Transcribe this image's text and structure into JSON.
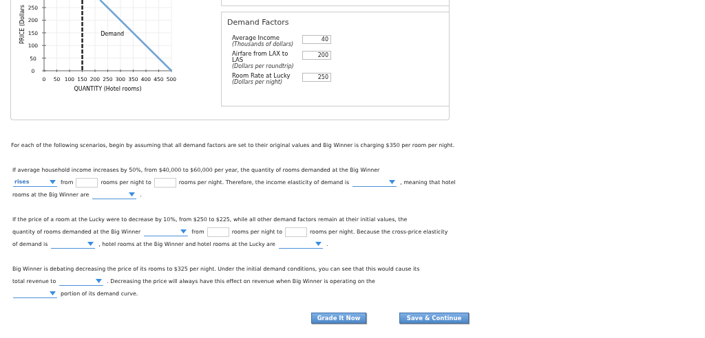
{
  "graph": {
    "chart_data": {
      "type": "line",
      "xlabel": "QUANTITY (Hotel rooms)",
      "ylabel": "PRICE (Dollars",
      "x": [
        220,
        500
      ],
      "series": [
        {
          "name": "Demand",
          "color": "#6fa3d4",
          "values": [
            280,
            0
          ]
        }
      ],
      "xlim": [
        0,
        500
      ],
      "ylim": [
        0,
        280
      ],
      "xticks": [
        0,
        50,
        100,
        150,
        200,
        250,
        300,
        350,
        400,
        450,
        500
      ],
      "yticks": [
        0,
        50,
        100,
        150,
        200,
        250
      ],
      "grid": true,
      "ref_lines": [
        {
          "axis": "x",
          "value": 150,
          "color": "#222222"
        }
      ]
    }
  },
  "demand_factors": {
    "title": "Demand Factors",
    "factors": [
      {
        "label": "Average Income",
        "unit": "(Thousands of dollars)",
        "value": "40"
      },
      {
        "label": "Airfare from LAX to LAS",
        "unit": "(Dollars per roundtrip)",
        "value": "200"
      },
      {
        "label": "Room Rate at Lucky",
        "unit": "(Dollars per night)",
        "value": "250"
      }
    ]
  },
  "intro": "For each of the following scenarios, begin by assuming that all demand factors are set to their original values and Big Winner is charging $350 per room per night.",
  "questions": [
    [
      {
        "kind": "text",
        "text": "If average household income increases by 50%, from $40,000 to $60,000 per year, the quantity of rooms demanded at the Big Winner"
      },
      {
        "kind": "break"
      },
      {
        "kind": "select",
        "value": "rises"
      },
      {
        "kind": "text",
        "text": "from"
      },
      {
        "kind": "input"
      },
      {
        "kind": "text",
        "text": "rooms per night to"
      },
      {
        "kind": "input"
      },
      {
        "kind": "text",
        "text": "rooms per night. Therefore, the income elasticity of demand is"
      },
      {
        "kind": "select"
      },
      {
        "kind": "text",
        "text": ", meaning that hotel"
      },
      {
        "kind": "break"
      },
      {
        "kind": "text",
        "text": "rooms at the Big Winner are"
      },
      {
        "kind": "select"
      },
      {
        "kind": "text",
        "text": "."
      }
    ],
    [
      {
        "kind": "text",
        "text": "If the price of a room at the Lucky were to decrease by 10%, from $250 to $225, while all other demand factors remain at their initial values, the"
      },
      {
        "kind": "break"
      },
      {
        "kind": "text",
        "text": "quantity of rooms demanded at the Big Winner"
      },
      {
        "kind": "select"
      },
      {
        "kind": "text",
        "text": "from"
      },
      {
        "kind": "input"
      },
      {
        "kind": "text",
        "text": "rooms per night to"
      },
      {
        "kind": "input"
      },
      {
        "kind": "text",
        "text": "rooms per night. Because the cross-price elasticity"
      },
      {
        "kind": "break"
      },
      {
        "kind": "text",
        "text": "of demand is"
      },
      {
        "kind": "select"
      },
      {
        "kind": "text",
        "text": ", hotel rooms at the Big Winner and hotel rooms at the Lucky are"
      },
      {
        "kind": "select"
      },
      {
        "kind": "text",
        "text": "."
      }
    ],
    [
      {
        "kind": "text",
        "text": "Big Winner is debating decreasing the price of its rooms to $325 per night. Under the initial demand conditions, you can see that this would cause its"
      },
      {
        "kind": "break"
      },
      {
        "kind": "text",
        "text": "total revenue to"
      },
      {
        "kind": "select"
      },
      {
        "kind": "text",
        "text": ". Decreasing the price will always have this effect on revenue when Big Winner is operating on the"
      },
      {
        "kind": "break"
      },
      {
        "kind": "select"
      },
      {
        "kind": "text",
        "text": "portion of its demand curve."
      }
    ]
  ],
  "buttons": [
    "Grade It Now",
    "Save & Continue"
  ]
}
